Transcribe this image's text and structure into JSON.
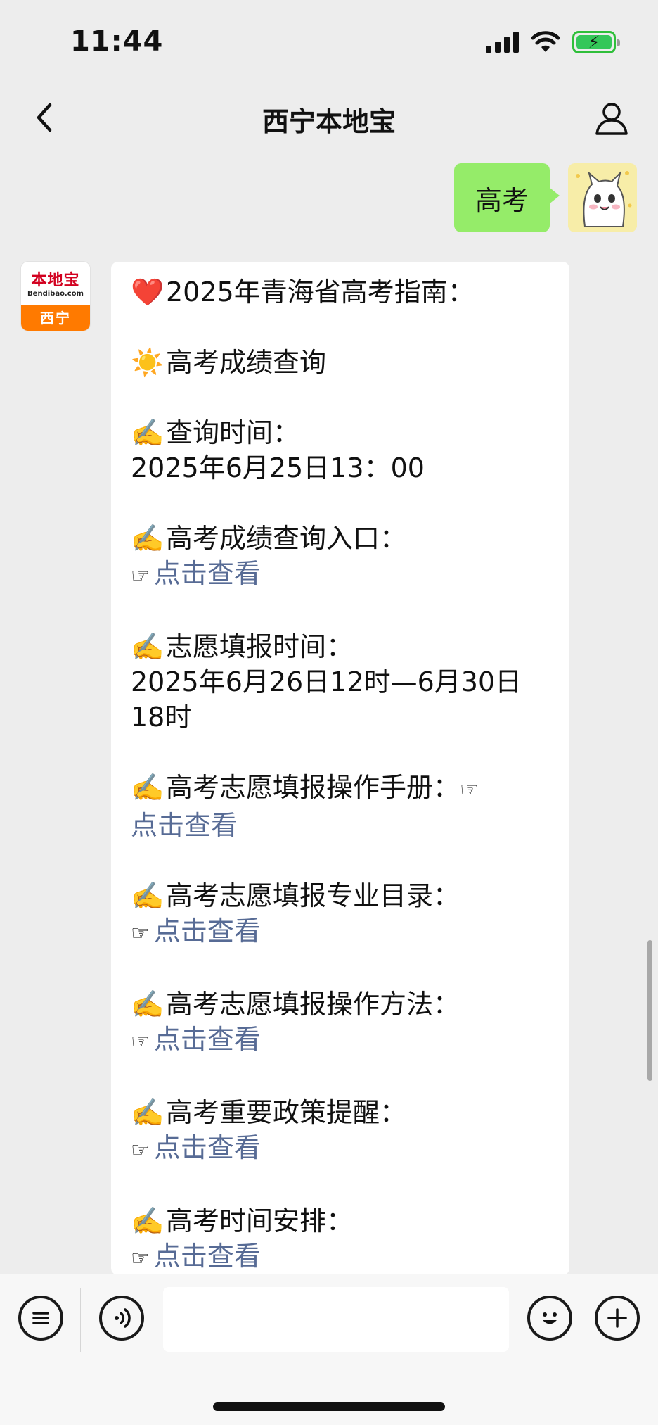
{
  "status_bar": {
    "time": "11:44"
  },
  "nav": {
    "title": "西宁本地宝"
  },
  "outgoing": {
    "text": "高考"
  },
  "bot_avatar": {
    "logo_cn": "本地宝",
    "logo_en": "Bendibao.com",
    "city": "西宁"
  },
  "message": {
    "title": "2025年青海省高考指南：",
    "section": "高考成绩查询",
    "query_time_label": "查询时间：",
    "query_time_value": "2025年6月25日13：00",
    "score_entry_label": "高考成绩查询入口：",
    "link_text": "点击查看",
    "fill_time_label": "志愿填报时间：",
    "fill_time_value_1": "2025年6月26日12时—6月30日",
    "fill_time_value_2": "18时",
    "manual_label": "高考志愿填报操作手册：",
    "major_catalog_label": "高考志愿填报专业目录：",
    "method_label": "高考志愿填报操作方法：",
    "policy_label": "高考重要政策提醒：",
    "schedule_label": "高考时间安排："
  },
  "icons": {
    "heart": "❤️",
    "sun": "☀️",
    "writing": "✍️",
    "pointing": "☞"
  },
  "colors": {
    "link": "#576b95",
    "bubble_out": "#95ec69",
    "background": "#ededed",
    "battery": "#34c759"
  }
}
